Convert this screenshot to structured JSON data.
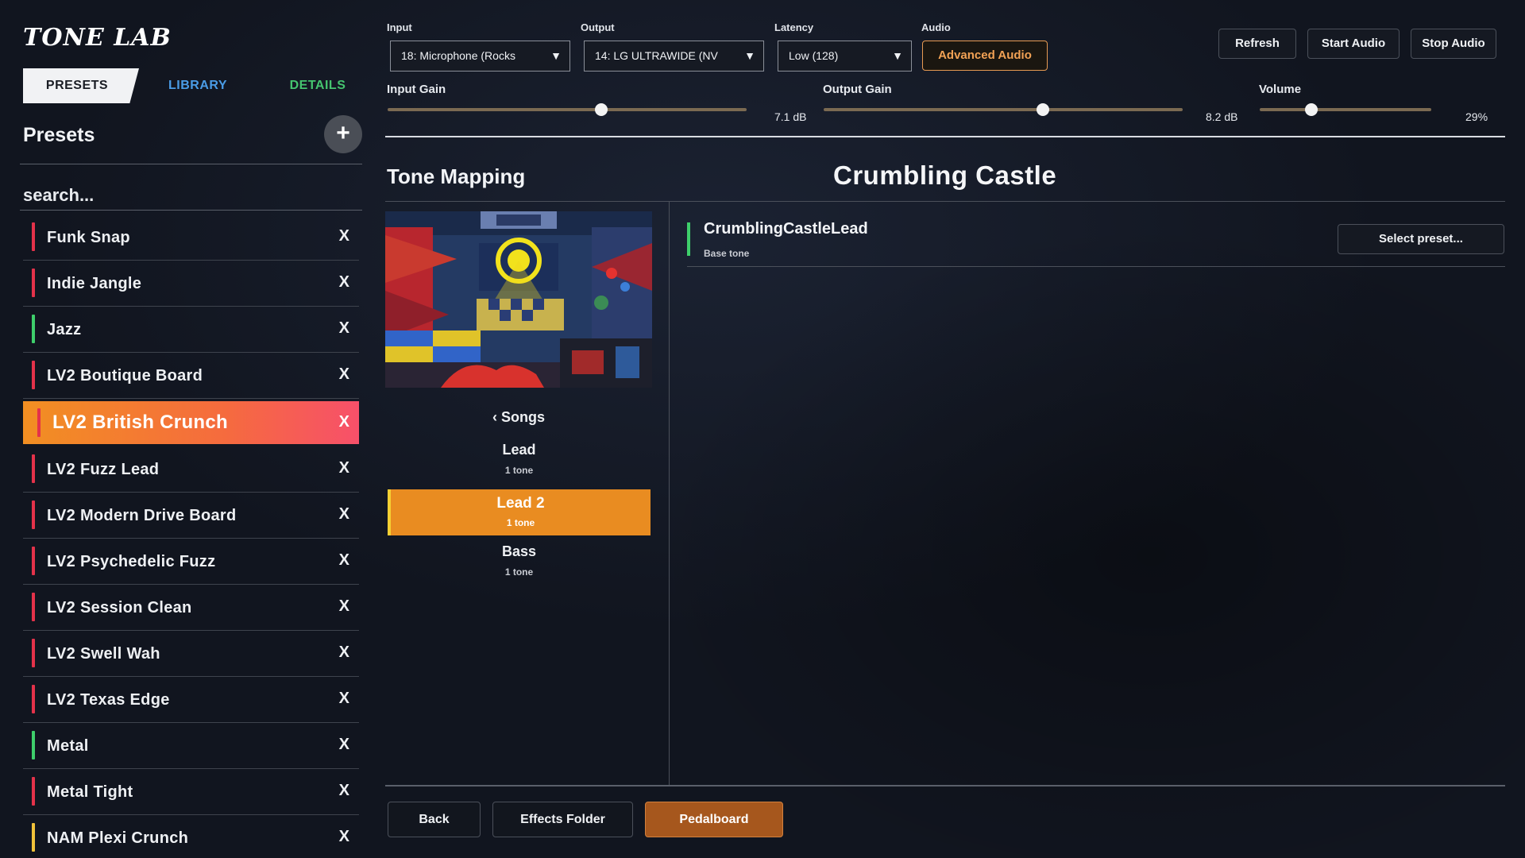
{
  "app": {
    "logo": "TONE LAB"
  },
  "sidebar": {
    "tabs": [
      {
        "label": "PRESETS",
        "active": true
      },
      {
        "label": "LIBRARY",
        "color": "#4a9ce6"
      },
      {
        "label": "DETAILS",
        "color": "#45c46f"
      }
    ],
    "title": "Presets",
    "add_icon": "plus-icon",
    "add_glyph": "+",
    "search": {
      "placeholder": "search...",
      "value": ""
    },
    "delete_glyph": "X",
    "presets": [
      {
        "name": "Funk Snap",
        "color": "#e4324a"
      },
      {
        "name": "Indie Jangle",
        "color": "#e4324a"
      },
      {
        "name": "Jazz",
        "color": "#3ecf6b"
      },
      {
        "name": "LV2 Boutique Board",
        "color": "#e4324a"
      },
      {
        "name": "LV2 British Crunch",
        "color": "#e4324a",
        "active": true
      },
      {
        "name": "LV2 Fuzz Lead",
        "color": "#e4324a"
      },
      {
        "name": "LV2 Modern Drive Board",
        "color": "#e4324a"
      },
      {
        "name": "LV2 Psychedelic Fuzz",
        "color": "#e4324a"
      },
      {
        "name": "LV2 Session Clean",
        "color": "#e4324a"
      },
      {
        "name": "LV2 Swell Wah",
        "color": "#e4324a"
      },
      {
        "name": "LV2 Texas Edge",
        "color": "#e4324a"
      },
      {
        "name": "Metal",
        "color": "#3ecf6b"
      },
      {
        "name": "Metal Tight",
        "color": "#e4324a"
      },
      {
        "name": "NAM Plexi Crunch",
        "color": "#f0c23a"
      }
    ]
  },
  "controls": {
    "input": {
      "label": "Input",
      "value": "18: Microphone (Rocks"
    },
    "output": {
      "label": "Output",
      "value": "14: LG ULTRAWIDE (NV"
    },
    "latency": {
      "label": "Latency",
      "value": "Low (128)"
    },
    "audio": {
      "label": "Audio",
      "button": "Advanced Audio"
    },
    "caret": "▼",
    "buttons": {
      "refresh": "Refresh",
      "start": "Start Audio",
      "stop": "Stop Audio"
    },
    "input_gain": {
      "label": "Input Gain",
      "value": "7.1 dB",
      "fraction": 0.595
    },
    "output_gain": {
      "label": "Output Gain",
      "value": "8.2 dB",
      "fraction": 0.61
    },
    "volume": {
      "label": "Volume",
      "value": "29%",
      "fraction": 0.3
    }
  },
  "main": {
    "section_title": "Tone Mapping",
    "song_title": "Crumbling Castle",
    "songs_back": "‹ Songs",
    "sections": [
      {
        "name": "Lead",
        "tones": "1 tone"
      },
      {
        "name": "Lead 2",
        "tones": "1 tone",
        "active": true
      },
      {
        "name": "Bass",
        "tones": "1 tone"
      }
    ],
    "tone": {
      "name": "CrumblingCastleLead",
      "subtitle": "Base tone",
      "select_button": "Select preset..."
    },
    "bottom": {
      "back": "Back",
      "effects_folder": "Effects Folder",
      "pedalboard": "Pedalboard"
    }
  },
  "colors": {
    "accent": "#e98c21",
    "active_gradient_start": "#f28f22",
    "active_gradient_end": "#f7506a"
  }
}
